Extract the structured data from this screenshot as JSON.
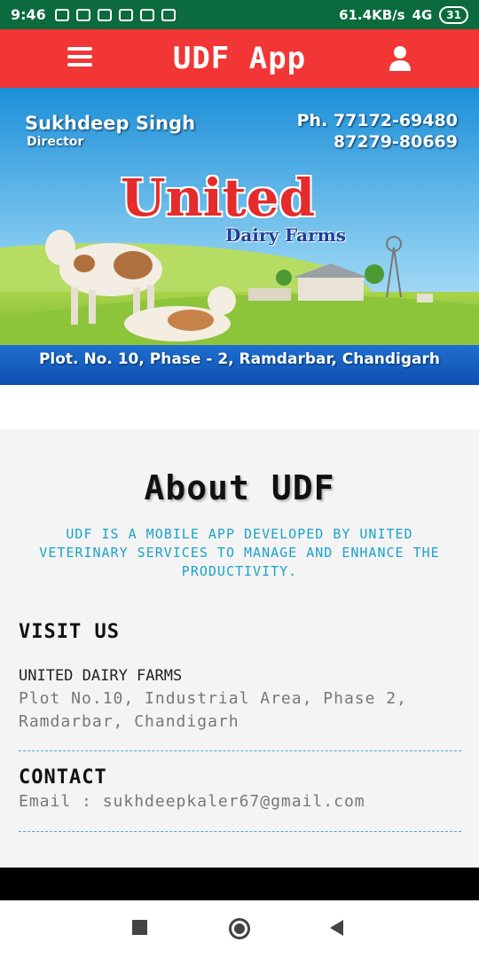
{
  "status_bar": {
    "time": "9:46",
    "speed": "61.4KB/s",
    "network": "4G",
    "battery": "31"
  },
  "app_bar": {
    "title": "UDF App",
    "menu_icon": "hamburger-menu-icon",
    "user_icon": "user-icon"
  },
  "banner": {
    "name": "Sukhdeep Singh",
    "role": "Director",
    "phone_line1": "Ph. 77172-69480",
    "phone_line2": "87279-80669",
    "logo_main": "United",
    "logo_sub": "Dairy Farms",
    "address": "Plot. No. 10, Phase - 2, Ramdarbar, Chandigarh"
  },
  "about": {
    "title": "About UDF",
    "description": "UDF is a mobile app developed by United Veterinary Services to manage and enhance the productivity."
  },
  "visit": {
    "heading": "VISIT US",
    "name": "UNITED DAIRY FARMS",
    "address": "Plot No.10, Industrial Area, Phase 2, Ramdarbar, Chandigarh"
  },
  "contact": {
    "heading": "CONTACT",
    "email_label": "Email : sukhdeepkaler67@gmail.com"
  },
  "colors": {
    "status_bar": "#0b6b3e",
    "app_bar": "#f23535",
    "accent_text": "#1aa3c8",
    "divider": "#4aa6e0"
  }
}
